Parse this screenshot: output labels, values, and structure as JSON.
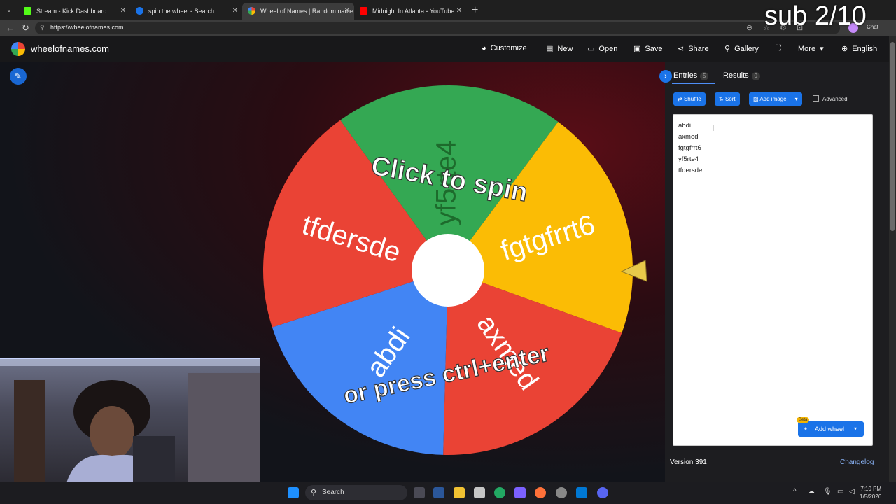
{
  "browser": {
    "tabs": [
      {
        "title": "Stream - Kick Dashboard",
        "favicon_color": "#53fc18",
        "active": false
      },
      {
        "title": "spin the wheel - Search",
        "favicon_color": "#1a73e8",
        "active": false
      },
      {
        "title": "Wheel of Names | Random name",
        "favicon_color": "#ea4335",
        "active": true
      },
      {
        "title": "Midnight In Atlanta - YouTube",
        "favicon_color": "#ff0000",
        "active": false
      }
    ],
    "url": "https://wheelofnames.com",
    "chat_label": "Chat"
  },
  "site": {
    "logo_text": "wheelofnames.com",
    "nav": [
      {
        "label": "Customize",
        "icon": "palette-icon"
      },
      {
        "label": "New",
        "icon": "file-icon"
      },
      {
        "label": "Open",
        "icon": "folder-icon"
      },
      {
        "label": "Save",
        "icon": "save-icon"
      },
      {
        "label": "Share",
        "icon": "share-icon"
      },
      {
        "label": "Gallery",
        "icon": "search-icon"
      },
      {
        "label": "",
        "icon": "fullscreen-icon"
      },
      {
        "label": "More",
        "icon": "chevron-down-icon"
      },
      {
        "label": "English",
        "icon": "globe-icon"
      }
    ]
  },
  "wheel": {
    "slices": [
      {
        "label": "yf5rte4",
        "color": "#34a853"
      },
      {
        "label": "fgtgfrrt6",
        "color": "#fbbc05"
      },
      {
        "label": "axmed",
        "color": "#ea4335"
      },
      {
        "label": "abdi",
        "color": "#4285f4"
      },
      {
        "label": "tfdersde",
        "color": "#ea4335"
      }
    ],
    "prompt_top": "Click to spin",
    "prompt_bottom": "or press ctrl+enter"
  },
  "panel": {
    "tabs": [
      {
        "label": "Entries",
        "count": "5"
      },
      {
        "label": "Results",
        "count": "0"
      }
    ],
    "buttons": {
      "shuffle": "Shuffle",
      "sort": "Sort",
      "add_image": "Add image",
      "advanced": "Advanced"
    },
    "entries": [
      "abdi",
      "axmed",
      "fgtgfrrt6",
      "yf5rte4",
      "tfdersde"
    ],
    "add_wheel": "Add wheel",
    "beta": "Beta",
    "version": "Version 391",
    "changelog": "Changelog"
  },
  "overlay": {
    "sub_text": "sub 2/10"
  },
  "taskbar": {
    "search_label": "Search",
    "time": "7:10 PM",
    "date": "1/5/2026"
  }
}
